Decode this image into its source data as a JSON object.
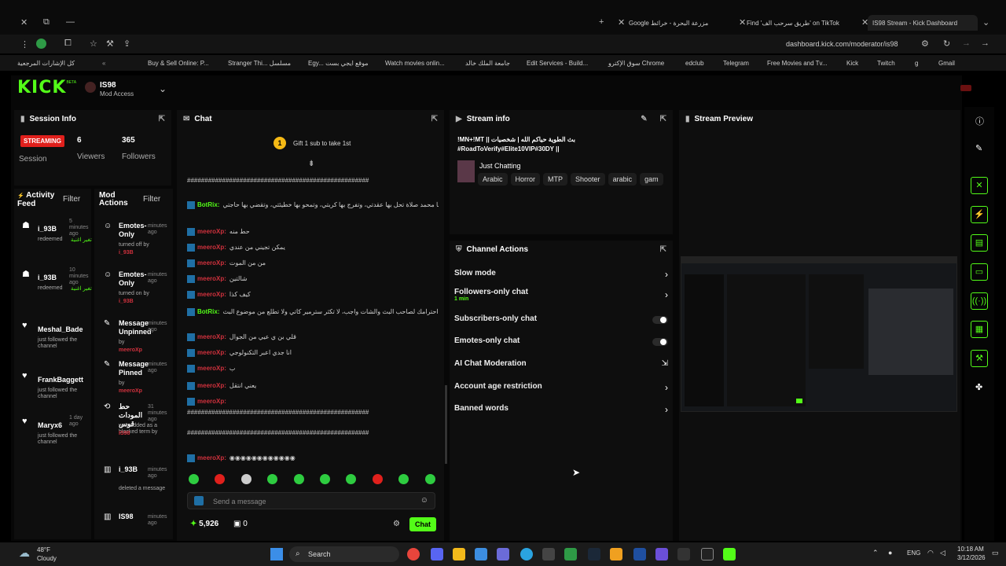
{
  "browser": {
    "tabs": [
      {
        "label": "Google مزرعة البحرة - خرائط"
      },
      {
        "label": "Find 'طريق سرحب الف' on TikTok"
      },
      {
        "label": "IS98 Stream - Kick Dashboard"
      }
    ],
    "url": "dashboard.kick.com/moderator/is98",
    "bookmarks": [
      "كل الإشارات المرجعية",
      "Buy & Sell Online: P...",
      "Stranger Thi... مسلسل",
      "Egy... موقع ايجي بست",
      "Watch movies onlin...",
      "جامعة الملك خالد",
      "Edit Services - Build...",
      "سوق الإكترو Chrome",
      "edclub",
      "Telegram",
      "Free Movies and Tv...",
      "Kick",
      "Twitch",
      "g",
      "Gmail"
    ]
  },
  "header": {
    "logo_text": "KICK",
    "logo_sup": "BETA",
    "channel_name": "IS98",
    "channel_role": "Mod Access"
  },
  "session": {
    "title": "Session Info",
    "streaming_badge": "STREAMING",
    "viewers_value": "6",
    "viewers_label": "Viewers",
    "followers_value": "365",
    "followers_label": "Followers",
    "session_label": "Session"
  },
  "activity": {
    "title": "Activity Feed",
    "filter": "Filter",
    "items": [
      {
        "user": "i_93B",
        "time": "5 minutes ago",
        "detail": "redeemed",
        "extra": "تغير اغنية"
      },
      {
        "user": "i_93B",
        "time": "10 minutes ago",
        "detail": "redeemed",
        "extra": "تغير اغنية"
      },
      {
        "user": "Meshal_Bade",
        "time": "",
        "detail": "just followed the channel",
        "extra": ""
      },
      {
        "user": "FrankBaggett",
        "time": "",
        "detail": "just followed the channel",
        "extra": ""
      },
      {
        "user": "Maryx6",
        "time": "1 day ago",
        "detail": "just followed the channel",
        "extra": ""
      }
    ]
  },
  "mod_actions": {
    "title": "Mod Actions",
    "filter": "Filter",
    "items": [
      {
        "title": "Emotes-Only",
        "time": "minutes ago",
        "detail": "turned off by",
        "by": "i_93B"
      },
      {
        "title": "Emotes-Only",
        "time": "minutes ago",
        "detail": "turned on by",
        "by": "i_93B"
      },
      {
        "title": "Message Unpinned",
        "time": "minutes ago",
        "detail": "by",
        "by": "meeroXp"
      },
      {
        "title": "Message Pinned",
        "time": "minutes ago",
        "detail": "by",
        "by": "meeroXp"
      },
      {
        "title": "حط المودات قوس",
        "time": "31 minutes ago",
        "detail": "was added as a blocked term by",
        "by": "IS98"
      },
      {
        "title": "i_93B",
        "time": "minutes ago",
        "detail": "deleted a message",
        "by": ""
      },
      {
        "title": "IS98",
        "time": "minutes ago",
        "detail": "",
        "by": ""
      }
    ]
  },
  "chat": {
    "title": "Chat",
    "gift_text": "Gift 1 sub to take 1st",
    "gift_rank": "1",
    "lines": [
      {
        "user": "",
        "text": "####################################################"
      },
      {
        "user": "BotRix:",
        "text": "اللهم صل وسلم على سيدنا محمد صلاة تحل بها عقدتي، وتفرج بها كربتي، وتمحو بها خطيئتي، وتقضي بها حاجتي"
      },
      {
        "user": "meeroXp:",
        "text": "حط منه"
      },
      {
        "user": "meeroXp:",
        "text": "يمكن تجيني من عندي"
      },
      {
        "user": "meeroXp:",
        "text": "من من الموت"
      },
      {
        "user": "meeroXp:",
        "text": "شالتين"
      },
      {
        "user": "meeroXp:",
        "text": "كيف كذا"
      },
      {
        "user": "BotRix:",
        "text": "احترامك لصاحب البث والشات واجب، لا تكثر سترمير كاتي ولا تطلع من موضوع البث"
      },
      {
        "user": "meeroXp:",
        "text": "قلي بن ي عيي من الجوال"
      },
      {
        "user": "meeroXp:",
        "text": "انا جدي اعبر التكنولوجي"
      },
      {
        "user": "meeroXp:",
        "text": "ب"
      },
      {
        "user": "meeroXp:",
        "text": "يعني انتقل"
      },
      {
        "user": "meeroXp:",
        "text": ""
      },
      {
        "user": "",
        "text": "####################################################"
      },
      {
        "user": "",
        "text": "####################################################"
      },
      {
        "user": "meeroXp:",
        "text": "◉◉◉◉◉◉◉◉◉◉◉◉"
      }
    ],
    "input_placeholder": "Send a message",
    "points": "5,926",
    "gifts": "0",
    "send_label": "Chat"
  },
  "stream_info": {
    "title": "Stream info",
    "stream_title": "!MN+!MT || بث الطوية حياكم الله | شخصيات #RoadToVerify#Elite10VIP#30DY ||",
    "category": "Just Chatting",
    "tags": [
      "Arabic",
      "Horror",
      "MTP",
      "Shooter",
      "arabic",
      "gam"
    ]
  },
  "channel_actions": {
    "title": "Channel Actions",
    "items": [
      {
        "label": "Slow mode",
        "control": "chevron",
        "sub": ""
      },
      {
        "label": "Followers-only chat",
        "control": "chevron",
        "sub": "1 min"
      },
      {
        "label": "Subscribers-only chat",
        "control": "toggle",
        "sub": ""
      },
      {
        "label": "Emotes-only chat",
        "control": "toggle",
        "sub": ""
      },
      {
        "label": "AI Chat Moderation",
        "control": "external",
        "sub": ""
      },
      {
        "label": "Account age restriction",
        "control": "chevron",
        "sub": ""
      },
      {
        "label": "Banned words",
        "control": "chevron",
        "sub": ""
      }
    ]
  },
  "stream_preview": {
    "title": "Stream Preview"
  },
  "taskbar": {
    "weather_temp": "48°F",
    "weather_desc": "Cloudy",
    "search": "Search",
    "lang": "ENG",
    "time": "10:18 AM",
    "date": "3/12/2026"
  },
  "colors": {
    "accent": "#53fc18",
    "live": "#e0201c",
    "bg": "#000000",
    "panel": "#0e0e0e"
  }
}
